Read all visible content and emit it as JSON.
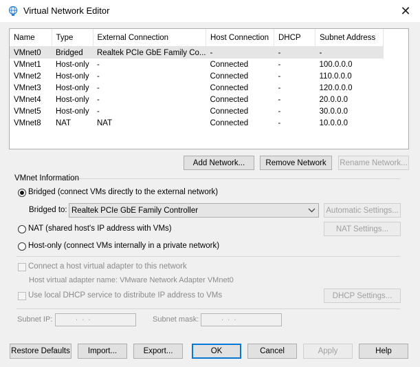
{
  "window": {
    "title": "Virtual Network Editor",
    "close": "✕"
  },
  "table": {
    "headers": [
      "Name",
      "Type",
      "External Connection",
      "Host Connection",
      "DHCP",
      "Subnet Address"
    ],
    "rows": [
      [
        "VMnet0",
        "Bridged",
        "Realtek PCIe GbE Family Co...",
        "-",
        "-",
        "-"
      ],
      [
        "VMnet1",
        "Host-only",
        "-",
        "Connected",
        "-",
        "100.0.0.0"
      ],
      [
        "VMnet2",
        "Host-only",
        "-",
        "Connected",
        "-",
        "110.0.0.0"
      ],
      [
        "VMnet3",
        "Host-only",
        "-",
        "Connected",
        "-",
        "120.0.0.0"
      ],
      [
        "VMnet4",
        "Host-only",
        "-",
        "Connected",
        "-",
        "20.0.0.0"
      ],
      [
        "VMnet5",
        "Host-only",
        "-",
        "Connected",
        "-",
        "30.0.0.0"
      ],
      [
        "VMnet8",
        "NAT",
        "NAT",
        "Connected",
        "-",
        "10.0.0.0"
      ]
    ]
  },
  "network_buttons": {
    "add": "Add Network...",
    "remove": "Remove Network",
    "rename": "Rename Network..."
  },
  "vmnet_info": {
    "legend": "VMnet Information",
    "bridged_label": "Bridged (connect VMs directly to the external network)",
    "bridged_to_label": "Bridged to:",
    "bridged_to_value": "Realtek PCIe GbE Family Controller",
    "automatic_settings": "Automatic Settings...",
    "nat_label": "NAT (shared host's IP address with VMs)",
    "nat_settings": "NAT Settings...",
    "hostonly_label": "Host-only (connect VMs internally in a private network)",
    "connect_adapter_label": "Connect a host virtual adapter to this network",
    "adapter_name_text": "Host virtual adapter name: VMware Network Adapter VMnet0",
    "dhcp_label": "Use local DHCP service to distribute IP address to VMs",
    "dhcp_settings": "DHCP Settings...",
    "subnet_ip_label": "Subnet IP:",
    "subnet_ip_value": " .  .  . ",
    "subnet_mask_label": "Subnet mask:",
    "subnet_mask_value": " .  .  . ",
    "selected_mode": "bridged"
  },
  "footer_buttons": {
    "restore": "Restore Defaults",
    "import": "Import...",
    "export": "Export...",
    "ok": "OK",
    "cancel": "Cancel",
    "apply": "Apply",
    "help": "Help"
  },
  "colors": {
    "accent": "#0078d7",
    "selected_row": "#e5e5e5"
  },
  "icons": {
    "title": "network-globe-icon",
    "close": "close-icon",
    "dropdown": "chevron-down-icon"
  }
}
